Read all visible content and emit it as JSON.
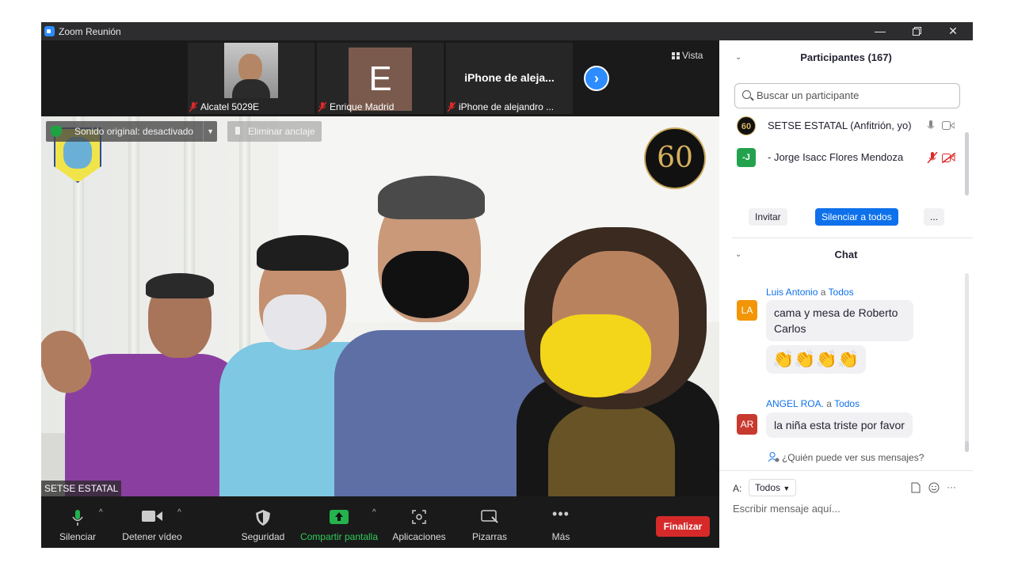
{
  "window": {
    "title": "Zoom Reunión"
  },
  "thumbnails": [
    {
      "name": "Alcatel 5029E"
    },
    {
      "name": "Enrique Madrid",
      "initial": "E"
    },
    {
      "name": "iPhone de alejandro ...",
      "display": "iPhone de aleja..."
    }
  ],
  "view_label": "Vista",
  "main_video": {
    "original_sound": "Sonido original: desactivado",
    "unpin": "Eliminar anclaje",
    "speaker": "SETSE ESTATAL",
    "logo_right_text": "60"
  },
  "toolbar": {
    "mute": "Silenciar",
    "stop_video": "Detener vídeo",
    "security": "Seguridad",
    "share": "Compartir pantalla",
    "apps": "Aplicaciones",
    "whiteboards": "Pizarras",
    "more": "Más",
    "end": "Finalizar"
  },
  "participants": {
    "title": "Participantes (167)",
    "search_placeholder": "Buscar un participante",
    "list": [
      {
        "name": "SETSE ESTATAL (Anfitrión, yo)",
        "avatar": "60",
        "avatar_color": "#111111"
      },
      {
        "name": "- Jorge Isacc Flores Mendoza",
        "avatar": "-J",
        "avatar_color": "#23a24d"
      }
    ],
    "invite": "Invitar",
    "mute_all": "Silenciar a todos",
    "more": "..."
  },
  "chat": {
    "title": "Chat",
    "messages": [
      {
        "sender": "Luis Antonio",
        "to_word": "a",
        "to": "Todos",
        "avatar": "LA",
        "avatar_color": "#f29507",
        "texts": [
          "cama y mesa de Roberto Carlos",
          "👏👏👏👏"
        ]
      },
      {
        "sender": "ANGEL ROA.",
        "to_word": "a",
        "to": "Todos",
        "avatar": "AR",
        "avatar_color": "#c8392f",
        "texts": [
          "la niña esta triste por favor"
        ]
      }
    ],
    "who_can_see": "¿Quién puede ver sus mensajes?",
    "to_label": "A:",
    "to_value": "Todos",
    "compose_placeholder": "Escribir mensaje aquí..."
  },
  "colors": {
    "accent": "#2d8cff",
    "end_red": "#d62a2a",
    "share_green": "#24b24c"
  }
}
